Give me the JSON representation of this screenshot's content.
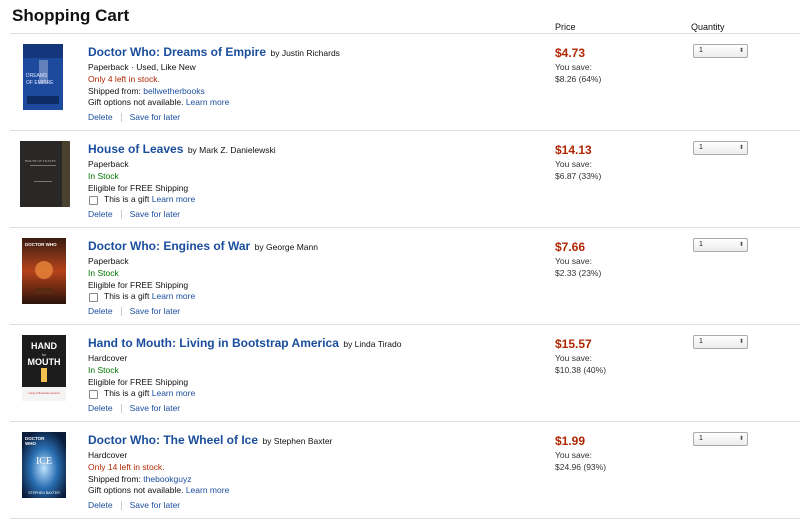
{
  "page": {
    "title": "Shopping Cart"
  },
  "columns": {
    "price": "Price",
    "quantity": "Quantity"
  },
  "labels": {
    "delete": "Delete",
    "save_for_later": "Save for later",
    "you_save": "You save:",
    "gift_checkbox": "This is a gift",
    "learn_more": "Learn more",
    "shipped_from": "Shipped from:"
  },
  "colors": {
    "link": "#1a4e9c",
    "price": "#b12704",
    "in_stock": "#007600"
  },
  "items": [
    {
      "title": "Doctor Who: Dreams of Empire",
      "author": "by Justin Richards",
      "format": "Paperback · Used, Like New",
      "availability": "Only 4 left in stock.",
      "seller": "bellwetherbooks",
      "gift_text": "Gift options not available.",
      "price": "$4.73",
      "you_save": "$8.26 (64%)",
      "quantity": "1"
    },
    {
      "title": "House of Leaves",
      "author": "by Mark Z. Danielewski",
      "format": "Paperback",
      "availability": "In Stock",
      "shipping": "Eligible for FREE Shipping",
      "price": "$14.13",
      "you_save": "$6.87 (33%)",
      "quantity": "1"
    },
    {
      "title": "Doctor Who: Engines of War",
      "author": "by George Mann",
      "format": "Paperback",
      "availability": "In Stock",
      "shipping": "Eligible for FREE Shipping",
      "price": "$7.66",
      "you_save": "$2.33 (23%)",
      "quantity": "1"
    },
    {
      "title": "Hand to Mouth: Living in Bootstrap America",
      "author": "by Linda Tirado",
      "format": "Hardcover",
      "availability": "In Stock",
      "shipping": "Eligible for FREE Shipping",
      "price": "$15.57",
      "you_save": "$10.38 (40%)",
      "quantity": "1"
    },
    {
      "title": "Doctor Who: The Wheel of Ice",
      "author": "by Stephen Baxter",
      "format": "Hardcover",
      "availability": "Only 14 left in stock.",
      "seller": "thebookguyz",
      "gift_text": "Gift options not available.",
      "price": "$1.99",
      "you_save": "$24.96 (93%)",
      "quantity": "1"
    }
  ],
  "covers": {
    "dreams_of_empire": {
      "line1": "DREAMS",
      "line2": "OF EMPIRE"
    },
    "house_of_leaves": {
      "line1": "HOUSE OF LEAVES"
    },
    "engines_of_war": {
      "line1": "DOCTOR WHO"
    },
    "hand_to_mouth": {
      "line1": "HAND",
      "line2": "to",
      "line3": "MOUTH",
      "line4": "Living in Bootstrap America"
    },
    "wheel_of_ice": {
      "line1": "DOCTOR",
      "line2": "WHO",
      "line3": "ICE",
      "line4": "STEPHEN BAXTER"
    }
  }
}
